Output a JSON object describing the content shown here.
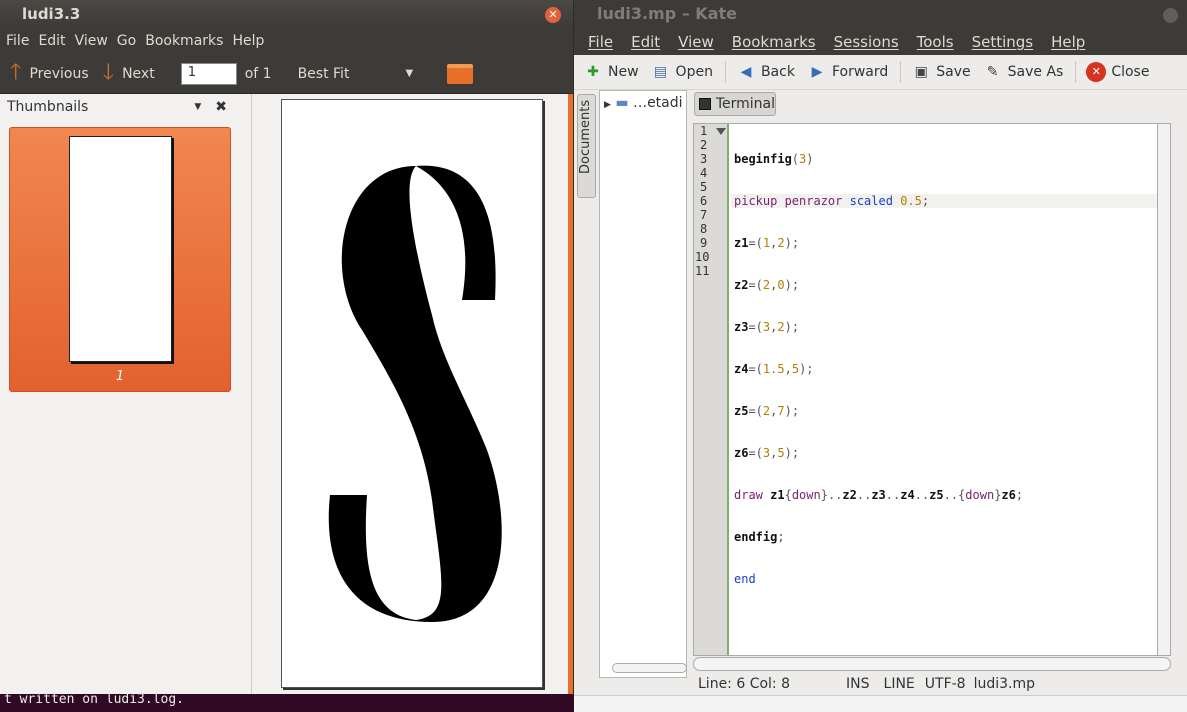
{
  "evince": {
    "title": "ludi3.3",
    "menu": [
      "File",
      "Edit",
      "View",
      "Go",
      "Bookmarks",
      "Help"
    ],
    "toolbar": {
      "previous": "Previous",
      "next": "Next",
      "page_value": "1",
      "page_of": "of 1",
      "zoom": "Best Fit"
    },
    "sidebar": {
      "title": "Thumbnails",
      "thumb_label": "1"
    }
  },
  "terminal": {
    "line1": "t written on ludi3.log."
  },
  "kate": {
    "title": "ludi3.mp – Kate",
    "menu": [
      "File",
      "Edit",
      "View",
      "Bookmarks",
      "Sessions",
      "Tools",
      "Settings",
      "Help"
    ],
    "toolbar": {
      "new": "New",
      "open": "Open",
      "back": "Back",
      "forward": "Forward",
      "save": "Save",
      "save_as": "Save As",
      "close": "Close"
    },
    "docs_tab": "Documents",
    "filesystem_item": "…etadi",
    "terminal_button": "Terminal",
    "line_numbers": [
      "1",
      "2",
      "3",
      "4",
      "5",
      "6",
      "7",
      "8",
      "9",
      "10",
      "11"
    ],
    "status": {
      "position": "Line: 6 Col: 8",
      "mode": "INS",
      "selection": "LINE",
      "encoding": "UTF-8",
      "file": "ludi3.mp"
    }
  },
  "colors": {
    "accent": "#e8702a",
    "titlebar": "#3c3b37",
    "terminal_bg": "#300a24"
  }
}
